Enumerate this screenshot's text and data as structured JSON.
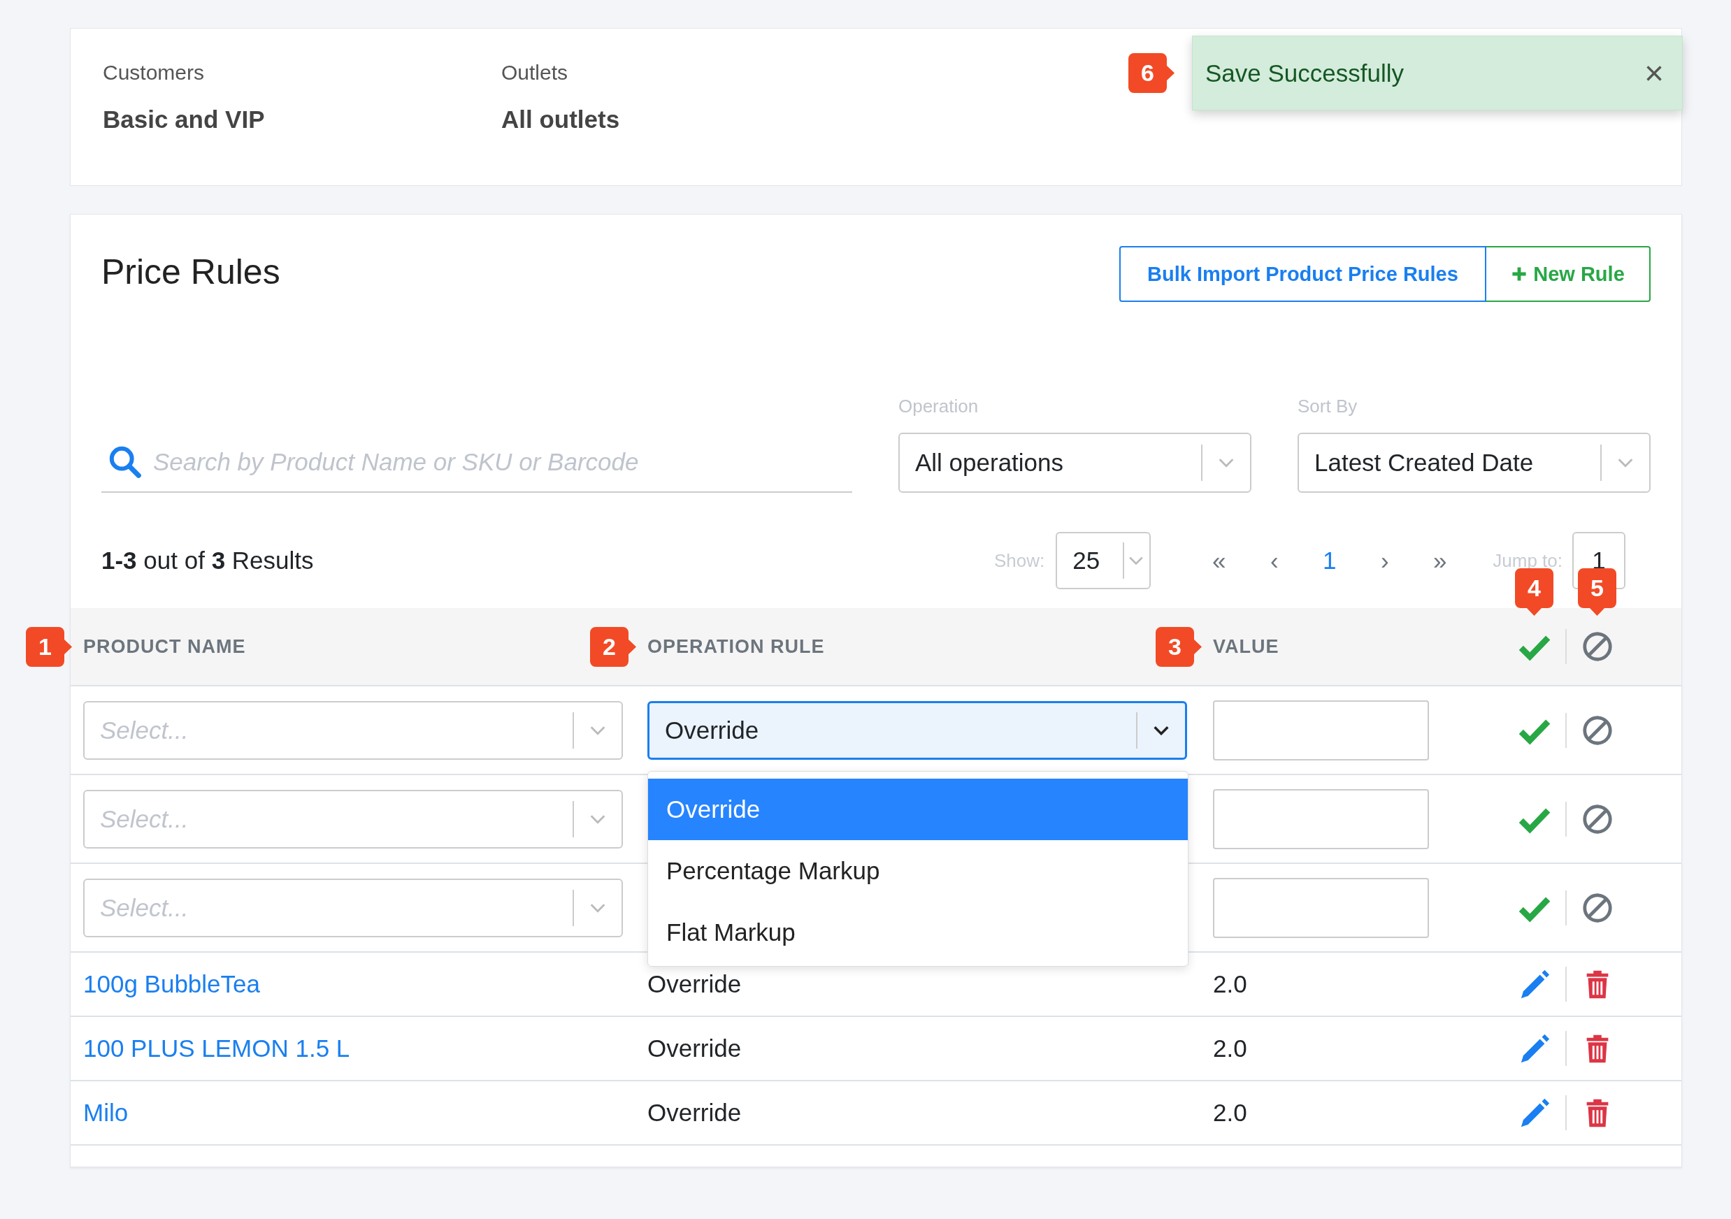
{
  "summary": {
    "fields": [
      {
        "label": "Customers",
        "value": "Basic and VIP"
      },
      {
        "label": "Outlets",
        "value": "All outlets"
      }
    ]
  },
  "toast": {
    "message": "Save Successfully",
    "close": "×",
    "callout": {
      "label": "6"
    }
  },
  "price_rules": {
    "title": "Price Rules",
    "buttons": [
      {
        "label": "Bulk Import Product Price Rules",
        "kind": "primary"
      },
      {
        "label": "New Rule",
        "kind": "add"
      }
    ],
    "search": {
      "placeholder": "Search by Product Name or SKU or Barcode"
    },
    "filters": [
      {
        "label": "Operation",
        "value": "All operations"
      },
      {
        "label": "Sort By",
        "value": "Latest Created Date"
      }
    ],
    "results": {
      "range": "1-3",
      "middle": "out of",
      "total": "3",
      "suffix": "Results"
    },
    "pagination": {
      "show_label": "Show:",
      "page_size": "25",
      "first": "«",
      "prev": "‹",
      "pages": [
        {
          "label": "1",
          "selected": true
        }
      ],
      "next": "›",
      "last": "»",
      "jump_label": "Jump to:",
      "jump_value": "1"
    },
    "columns": [
      {
        "label": "PRODUCT NAME",
        "callout": {
          "label": "1"
        }
      },
      {
        "label": "OPERATION RULE",
        "callout": {
          "label": "2"
        }
      },
      {
        "label": "VALUE",
        "callout": {
          "label": "3"
        }
      }
    ],
    "header_actions": [
      {
        "kind": "confirm",
        "callout": {
          "label": "4"
        }
      },
      {
        "kind": "cancel",
        "callout": {
          "label": "5"
        }
      }
    ],
    "edit_rows": [
      {
        "product_placeholder": "Select...",
        "operation": "Override",
        "open": true
      },
      {
        "product_placeholder": "Select..."
      },
      {
        "product_placeholder": "Select..."
      }
    ],
    "operation_options": [
      {
        "label": "Override",
        "selected": true
      },
      {
        "label": "Percentage Markup",
        "selected": false
      },
      {
        "label": "Flat Markup",
        "selected": false
      }
    ],
    "rows": [
      {
        "product": "100g BubbleTea",
        "operation": "Override",
        "value": "2.0"
      },
      {
        "product": "100 PLUS LEMON 1.5 L",
        "operation": "Override",
        "value": "2.0"
      },
      {
        "product": "Milo",
        "operation": "Override",
        "value": "2.0"
      }
    ]
  }
}
